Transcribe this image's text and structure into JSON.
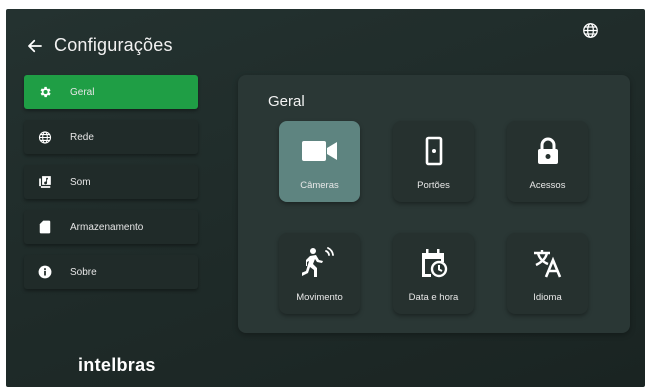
{
  "header": {
    "title": "Configurações",
    "back_icon": "arrow-left-icon",
    "language_icon": "globe-icon"
  },
  "sidebar": {
    "items": [
      {
        "label": "Geral",
        "icon": "gear-icon",
        "active": true
      },
      {
        "label": "Rede",
        "icon": "globe-icon",
        "active": false
      },
      {
        "label": "Som",
        "icon": "music-library-icon",
        "active": false
      },
      {
        "label": "Armazenamento",
        "icon": "sd-card-icon",
        "active": false
      },
      {
        "label": "Sobre",
        "icon": "info-icon",
        "active": false
      }
    ]
  },
  "main": {
    "title": "Geral",
    "tiles": [
      {
        "label": "Câmeras",
        "icon": "video-camera-icon",
        "active": true
      },
      {
        "label": "Portões",
        "icon": "door-icon",
        "active": false
      },
      {
        "label": "Acessos",
        "icon": "lock-icon",
        "active": false
      },
      {
        "label": "Movimento",
        "icon": "motion-sensor-icon",
        "active": false
      },
      {
        "label": "Data e hora",
        "icon": "calendar-clock-icon",
        "active": false
      },
      {
        "label": "Idioma",
        "icon": "translate-icon",
        "active": false
      }
    ]
  },
  "brand": {
    "logo_text": "intelbras"
  },
  "colors": {
    "accent": "#1f9e45",
    "background": "#1e2927",
    "panel": "#2a3735",
    "tile_active": "#5e8480"
  }
}
